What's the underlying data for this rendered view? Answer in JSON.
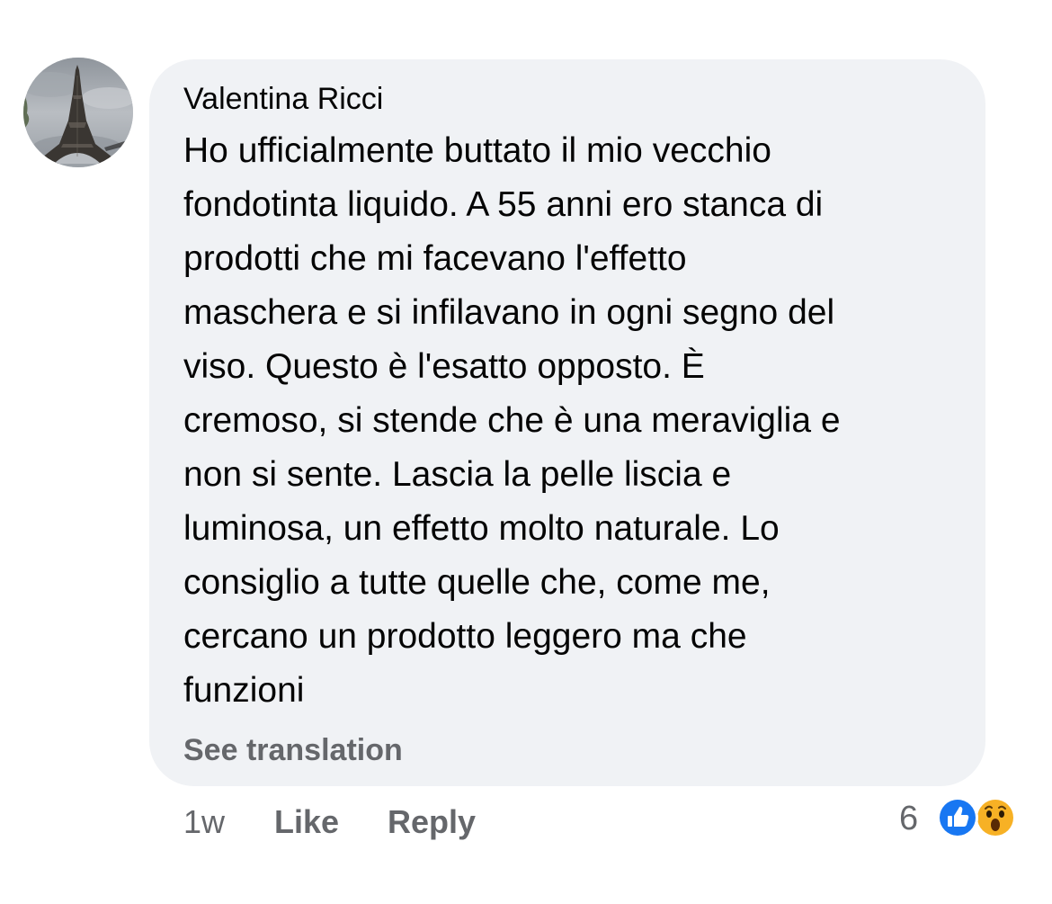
{
  "comment": {
    "author": "Valentina Ricci",
    "text_lines": [
      "Ho ufficialmente buttato il mio vecchio",
      "fondotinta liquido. A 55 anni ero stanca di",
      "prodotti che mi facevano l'effetto",
      "maschera e si infilavano in ogni segno del",
      "viso. Questo è l'esatto opposto. È",
      "cremoso, si stende che è una meraviglia e",
      "non si sente. Lascia la pelle liscia e",
      "luminosa, un effetto molto naturale. Lo",
      "consiglio a tutte quelle che, come me,",
      "cercano un prodotto leggero ma che",
      "funzioni"
    ],
    "see_translation": "See translation"
  },
  "actions": {
    "timestamp": "1w",
    "like_label": "Like",
    "reply_label": "Reply"
  },
  "reactions": {
    "count": "6",
    "icons": [
      "like-reaction-icon",
      "wow-reaction-icon"
    ],
    "like_color": "#1877f2",
    "wow_color": "#f7b125"
  },
  "colors": {
    "bubble_bg": "#f0f2f5",
    "text": "#050505",
    "secondary_text": "#65676b"
  }
}
